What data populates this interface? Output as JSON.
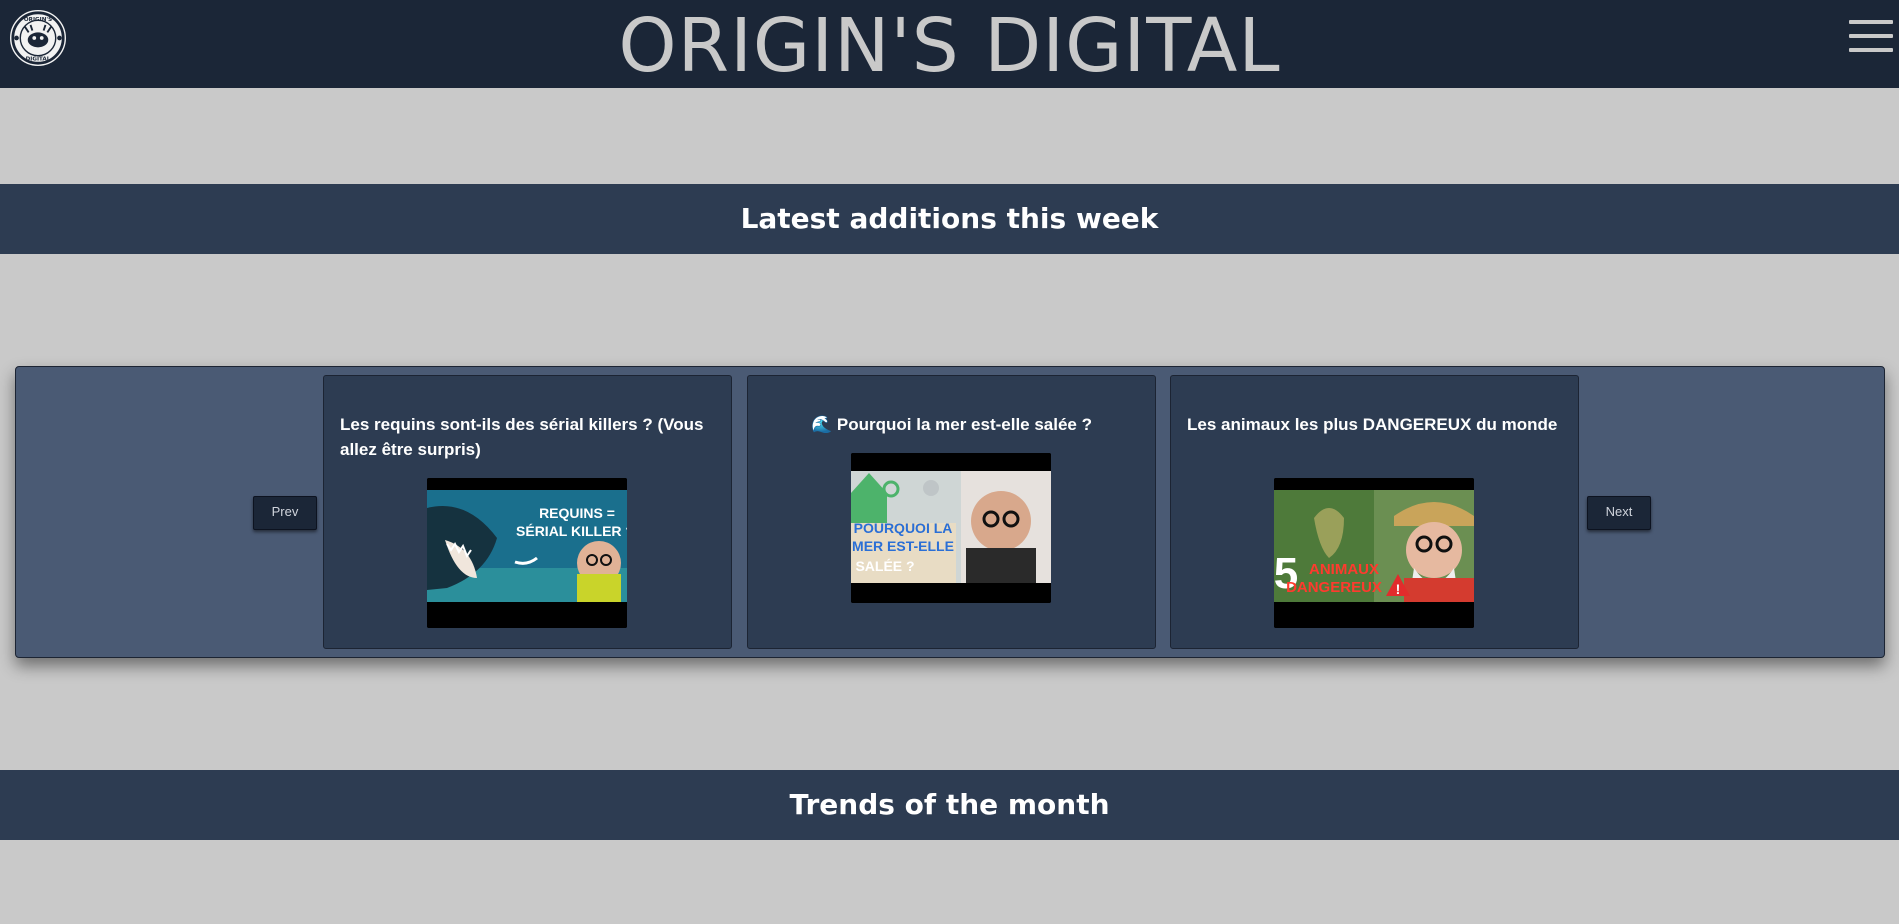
{
  "header": {
    "logo_text_top": "ORIGIN'S",
    "logo_text_bottom": "DIGITAL",
    "site_title": "ORIGIN'S DIGITAL"
  },
  "sections": {
    "latest": "Latest additions this week",
    "trends": "Trends of the month"
  },
  "carousel": {
    "prev_label": "Prev",
    "next_label": "Next",
    "cards": [
      {
        "title": "Les requins sont-ils des sérial killers ? (Vous allez être surpris)",
        "thumb_text_1": "REQUINS =",
        "thumb_text_2": "SÉRIAL KILLER ?"
      },
      {
        "title_icon": "🌊",
        "title": "Pourquoi la mer est-elle salée ?",
        "thumb_text_1": "POURQUOI LA",
        "thumb_text_2": "MER EST-ELLE",
        "thumb_text_3": "SALÉE ?"
      },
      {
        "title": "Les animaux les plus DANGEREUX du monde",
        "thumb_text_1": "5",
        "thumb_text_2": "ANIMAUX",
        "thumb_text_3": "DANGEREUX",
        "thumb_text_4": "!"
      }
    ]
  },
  "colors": {
    "page_bg": "#c9c9c9",
    "topbar_bg": "#1b2637",
    "band_bg": "#2d3c52",
    "carousel_bg": "#4a5a74",
    "card_bg": "#2d3c52"
  }
}
